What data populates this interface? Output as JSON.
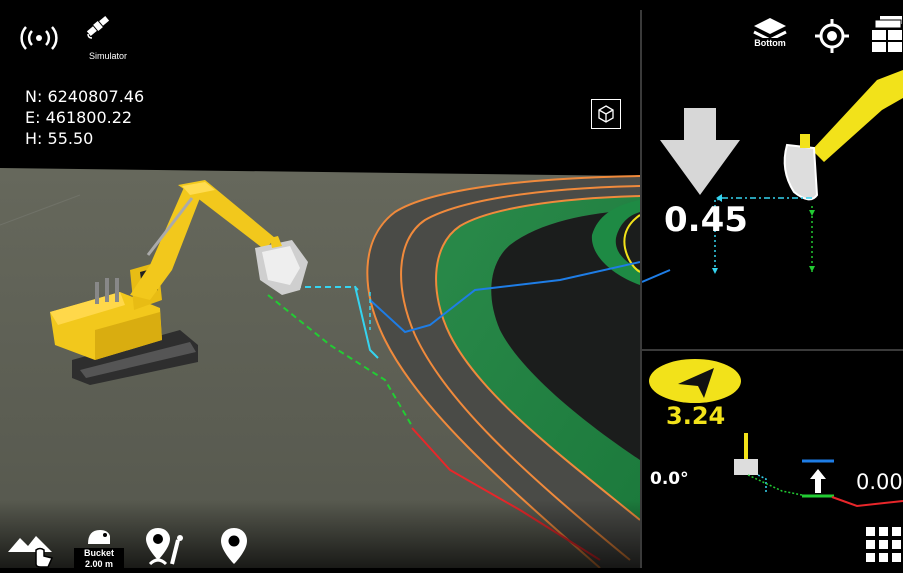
{
  "status": {
    "signal_icon": "wireless-signal-icon",
    "satellite_icon": "satellite-icon",
    "mode_label": "Simulator"
  },
  "position": {
    "north": "N: 6240807.46",
    "east": "E: 461800.22",
    "height": "H: 55.50"
  },
  "toolbar_top": {
    "layers_label": "Bottom",
    "layers_icon": "layers-icon",
    "locate_icon": "target-icon",
    "views_icon": "views-icon"
  },
  "view_cube_icon": "view-cube-icon",
  "cut_fill": {
    "direction": "down",
    "value": "0.45"
  },
  "heading": {
    "value": "3.24"
  },
  "profile": {
    "tilt": "0.0°",
    "offset": "0.00"
  },
  "bottom_toolbar": {
    "terrain_icon": "terrain-tap-icon",
    "bucket_label": "Bucket",
    "bucket_width": "2.00 m",
    "point_line_icon": "point-line-icon",
    "location_icon": "location-pin-icon",
    "keypad_icon": "keypad-icon"
  },
  "colors": {
    "accent_yellow": "#f2e21a",
    "design_green": "#1aa34a",
    "design_orange": "#f08a3c",
    "guide_cyan": "#35d4f0",
    "guide_blue": "#1e7de6",
    "guide_red": "#e8262a"
  }
}
